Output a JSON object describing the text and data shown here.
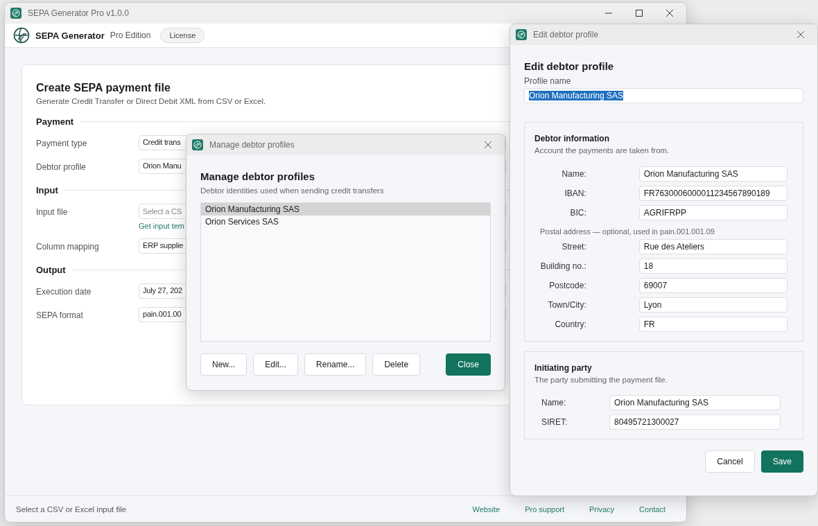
{
  "main_window": {
    "title": "SEPA Generator Pro v1.0.0",
    "header": {
      "app_name": "SEPA Generator",
      "edition": "Pro Edition",
      "license_button": "License"
    },
    "card": {
      "title": "Create SEPA payment file",
      "subtitle": "Generate Credit Transfer or Direct Debit XML from CSV or Excel.",
      "sections": [
        {
          "heading": "Payment",
          "rows": [
            {
              "label": "Payment type",
              "kind": "select",
              "value": "Credit trans"
            },
            {
              "label": "Debtor profile",
              "kind": "select",
              "value": "Orion Manu"
            }
          ]
        },
        {
          "heading": "Input",
          "rows": [
            {
              "label": "Input file",
              "kind": "file",
              "placeholder": "Select a CS",
              "link": "Get input tem"
            },
            {
              "label": "Column mapping",
              "kind": "select",
              "value": "ERP supplie"
            }
          ]
        },
        {
          "heading": "Output",
          "rows": [
            {
              "label": "Execution date",
              "kind": "select",
              "value": "July 27, 202"
            },
            {
              "label": "SEPA format",
              "kind": "select",
              "value": "pain.001.00"
            }
          ]
        }
      ]
    },
    "status_bar": {
      "text": "Select a CSV or Excel input file",
      "links": [
        "Website",
        "Pro support",
        "Privacy",
        "Contact"
      ]
    }
  },
  "manage_dialog": {
    "title": "Manage debtor profiles",
    "heading": "Manage debtor profiles",
    "subtitle": "Debtor identities used when sending credit transfers",
    "profiles": [
      {
        "name": "Orion Manufacturing SAS",
        "selected": true
      },
      {
        "name": "Orion Services SAS",
        "selected": false
      }
    ],
    "buttons": [
      {
        "label": "New...",
        "kind": "secondary"
      },
      {
        "label": "Edit...",
        "kind": "secondary"
      },
      {
        "label": "Rename...",
        "kind": "secondary"
      },
      {
        "label": "Delete",
        "kind": "secondary"
      },
      {
        "label": "Close",
        "kind": "primary"
      }
    ]
  },
  "edit_dialog": {
    "title": "Edit debtor profile",
    "heading": "Edit debtor profile",
    "profile_name_label": "Profile name",
    "profile_name": {
      "value": "Orion Manufacturing SAS",
      "text_selected": true
    },
    "groups": [
      {
        "kind": "aligned",
        "title": "Debtor information",
        "subtitle": "Account the payments are taken from.",
        "rows": [
          {
            "kind": "field",
            "label": "Name:",
            "value": "Orion Manufacturing SAS"
          },
          {
            "kind": "field",
            "label": "IBAN:",
            "value": "FR7630006000011234567890189"
          },
          {
            "kind": "field",
            "label": "BIC:",
            "value": "AGRIFRPP"
          },
          {
            "kind": "note",
            "text": "Postal address — optional, used in pain.001.001.09"
          },
          {
            "kind": "field",
            "label": "Street:",
            "value": "Rue des Ateliers"
          },
          {
            "kind": "field",
            "label": "Building no.:",
            "value": "18"
          },
          {
            "kind": "field",
            "label": "Postcode:",
            "value": "69007"
          },
          {
            "kind": "field",
            "label": "Town/City:",
            "value": "Lyon"
          },
          {
            "kind": "field",
            "label": "Country:",
            "value": "FR"
          }
        ]
      },
      {
        "kind": "compact",
        "title": "Initiating party",
        "subtitle": "The party submitting the payment file.",
        "rows": [
          {
            "kind": "field",
            "label": "Name:",
            "value": "Orion Manufacturing SAS"
          },
          {
            "kind": "field",
            "label": "SIRET:",
            "value": "80495721300027"
          }
        ]
      }
    ],
    "buttons": [
      {
        "label": "Cancel",
        "kind": "secondary"
      },
      {
        "label": "Save",
        "kind": "primary"
      }
    ]
  }
}
